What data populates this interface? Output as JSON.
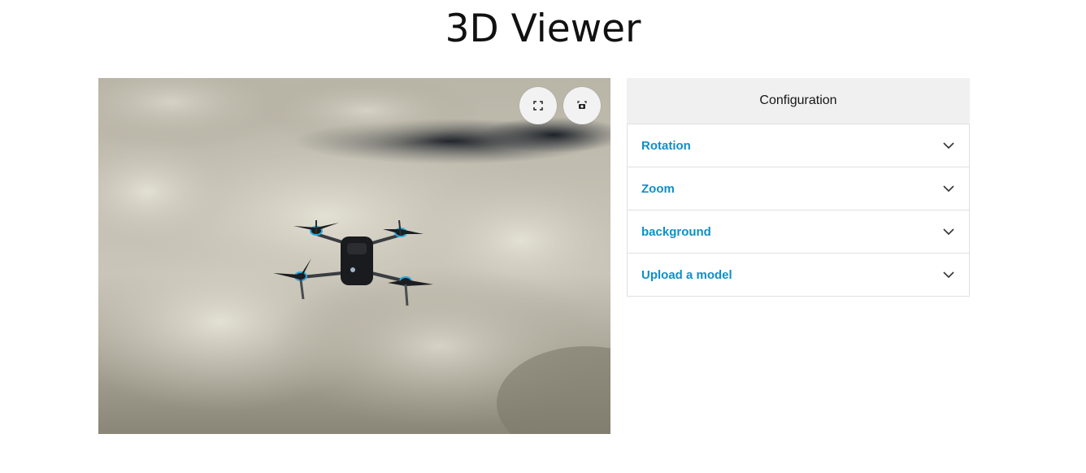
{
  "page": {
    "title": "3D Viewer"
  },
  "viewer": {
    "fullscreen_icon": "fullscreen-icon",
    "screenshot_icon": "screenshot-icon",
    "scene": "drone-above-clouds"
  },
  "config": {
    "title": "Configuration",
    "sections": [
      {
        "label": "Rotation",
        "icon": "chevron-down-icon"
      },
      {
        "label": "Zoom",
        "icon": "chevron-down-icon"
      },
      {
        "label": "background",
        "icon": "chevron-down-icon"
      },
      {
        "label": "Upload a model",
        "icon": "chevron-down-icon"
      }
    ]
  },
  "colors": {
    "accent": "#0f8fc8",
    "header_bg": "#f0f0f0",
    "border": "#e0e0e0"
  }
}
